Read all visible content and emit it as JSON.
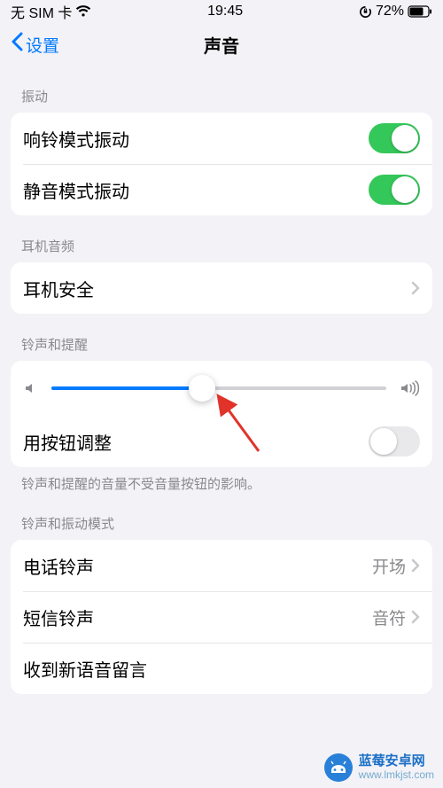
{
  "status": {
    "left": "无 SIM 卡",
    "time": "19:45",
    "battery": "72%"
  },
  "nav": {
    "back": "设置",
    "title": "声音"
  },
  "sections": {
    "vibration": {
      "header": "振动",
      "ringRow": "响铃模式振动",
      "silentRow": "静音模式振动"
    },
    "headphone": {
      "header": "耳机音频",
      "safetyRow": "耳机安全"
    },
    "ringer": {
      "header": "铃声和提醒",
      "buttonChange": "用按钮调整",
      "footer": "铃声和提醒的音量不受音量按钮的影响。",
      "sliderPercent": 45
    },
    "sounds": {
      "header": "铃声和振动模式",
      "ringtoneRow": "电话铃声",
      "ringtoneValue": "开场",
      "textRow": "短信铃声",
      "textValue": "音符",
      "voicemailRow": "收到新语音留言"
    }
  },
  "watermark": {
    "brand": "蓝莓安卓网",
    "url": "www.lmkjst.com"
  }
}
